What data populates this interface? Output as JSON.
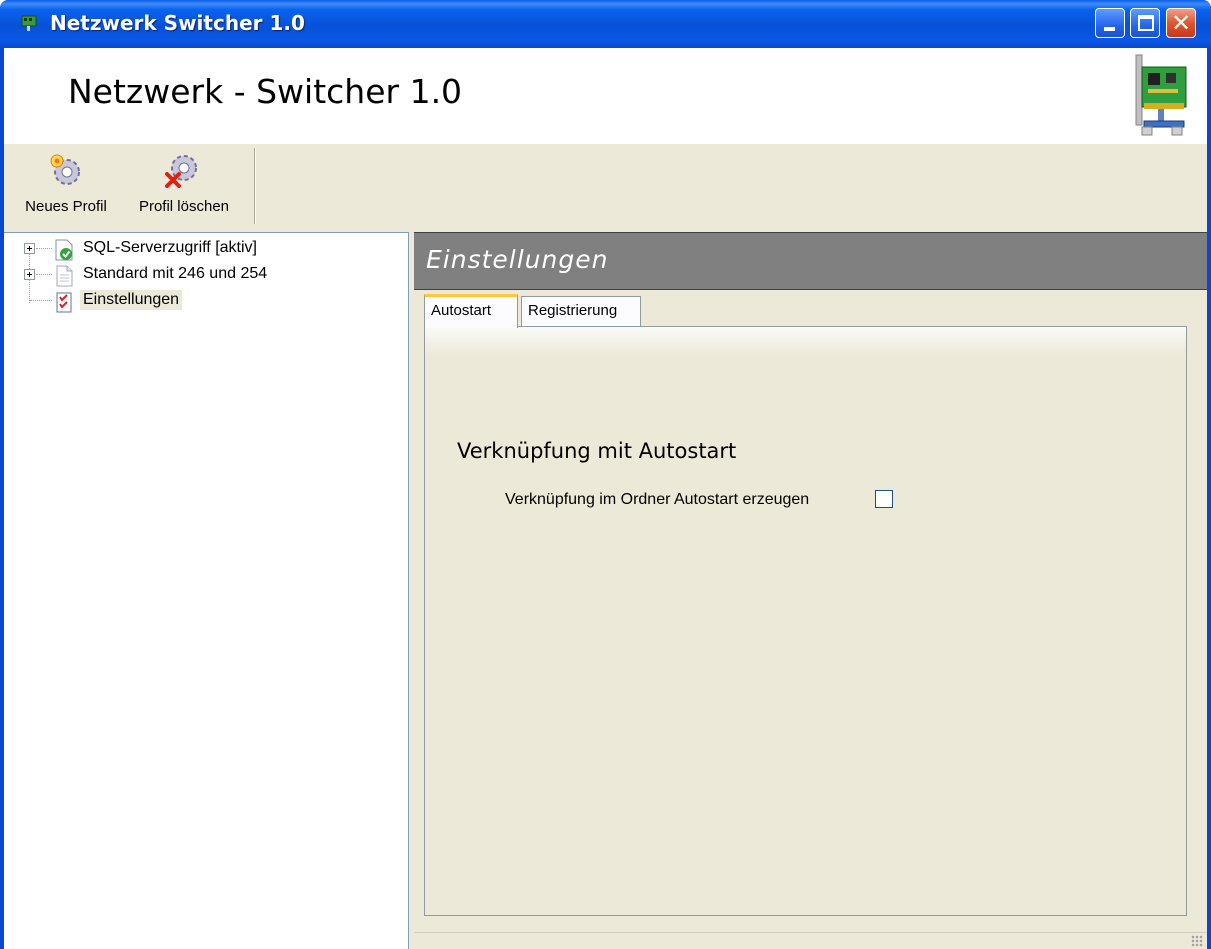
{
  "window": {
    "title": "Netzwerk Switcher 1.0",
    "controls": {
      "minimize": "minimize",
      "maximize": "maximize",
      "close": "close"
    }
  },
  "header": {
    "app_title": "Netzwerk - Switcher 1.0",
    "icon": "network-card-icon"
  },
  "toolbar": {
    "new_profile_label": "Neues Profil",
    "new_profile_icon": "gear-new-icon",
    "delete_profile_label": "Profil löschen",
    "delete_profile_icon": "gear-delete-icon"
  },
  "tree": {
    "items": [
      {
        "label": "SQL-Serverzugriff [aktiv]",
        "icon": "profile-active-icon",
        "expandable": true
      },
      {
        "label": "Standard mit 246 und 254",
        "icon": "profile-document-icon",
        "expandable": true
      },
      {
        "label": "Einstellungen",
        "icon": "settings-checklist-icon",
        "expandable": false,
        "selected": true
      }
    ]
  },
  "content": {
    "section_title": "Einstellungen",
    "tabs": [
      {
        "label": "Autostart",
        "active": true
      },
      {
        "label": "Registrierung",
        "active": false
      }
    ],
    "group_title": "Verknüpfung mit Autostart",
    "option_label": "Verknüpfung im Ordner Autostart erzeugen",
    "option_checked": false
  },
  "colors": {
    "title_bar": "#0054e3",
    "section_header_bg": "#808080",
    "window_bg": "#ece9d8",
    "tab_accent": "#ffc83c"
  }
}
